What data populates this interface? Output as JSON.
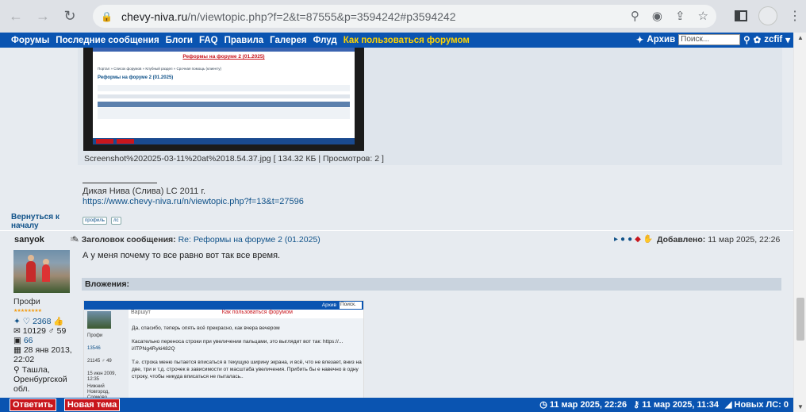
{
  "browser": {
    "url_domain": "chevy-niva.ru",
    "url_path": "/n/viewtopic.php?f=2&t=87555&p=3594242#p3594242"
  },
  "topnav": {
    "items": [
      "Форумы",
      "Последние сообщения",
      "Блоги",
      "FAQ",
      "Правила",
      "Галерея",
      "Флуд"
    ],
    "help": "Как пользоваться форумом",
    "archive": "Архив",
    "search_placeholder": "Поиск...",
    "user": "zcfif"
  },
  "post1": {
    "thumb_title": "Реформы на форуме 2 (01.2025)",
    "thumb_crumb": "Портал » Список форумов » Клубный раздел » Срочная помощь (клиенту)",
    "thumb_heading": "Реформы на форуме 2 (01.2025)",
    "caption": "Screenshot%202025-03-11%20at%2018.54.37.jpg [ 134.32 КБ | Просмотров: 2 ]",
    "signature_text": "Дикая Нива (Слива) LC 2011 г.",
    "signature_link": "https://www.chevy-niva.ru/n/viewtopic.php?f=13&t=27596",
    "back_to_top": "Вернуться к началу",
    "profile_btn": "профиль",
    "pm_btn": "лс"
  },
  "post2": {
    "author": "sanyok",
    "rank": "Профи",
    "stars": "★★★★★★★★",
    "reputation": "2368",
    "posts": "10129",
    "gender_count": "59",
    "photos": "66",
    "registered": "28 янв 2013, 22:02",
    "location": "Ташла, Оренбургской обл.",
    "subject_label": "Заголовок сообщения:",
    "subject": "Re: Реформы на форуме 2 (01.2025)",
    "added_label": "Добавлено:",
    "date": "11 мар 2025, 22:26",
    "text": "А у меня почему то все равно вот так все время.",
    "attachments_label": "Вложения:",
    "attach": {
      "archive": "Архив",
      "search": "Поиск.",
      "user_rank": "Профи",
      "user_rep": "13546",
      "user_stats": "21145 ♂ 49",
      "user_reg": "15 июн 2009, 12:35",
      "user_loc": "Нижний Новгород, Сормово",
      "reply_to": "Варшут",
      "help": "Как пользоваться форумом",
      "p1": "Да, спасибо, теперь опять всё прекрасно, как вчера вечером",
      "p2": "Касательно переноса строки при увеличении пальцами, это выглядит вот так: https://... i/ITPNg4Ryki482Q",
      "p3": "Т.е. строка меню пытается вписаться в текущую ширину экрана, и всё, что не влезает, вниз на две, три и т.д. строчек в зависимости от масштаба увеличения. Прибить бы е навечно в одну строку, чтобы никуда вписаться не пыталась.."
    }
  },
  "bottombar": {
    "reply": "Ответить",
    "new_topic": "Новая тема",
    "time1": "11 мар 2025, 22:26",
    "time2": "11 мар 2025, 11:34",
    "new_pm": "Новых ЛС: 0"
  }
}
